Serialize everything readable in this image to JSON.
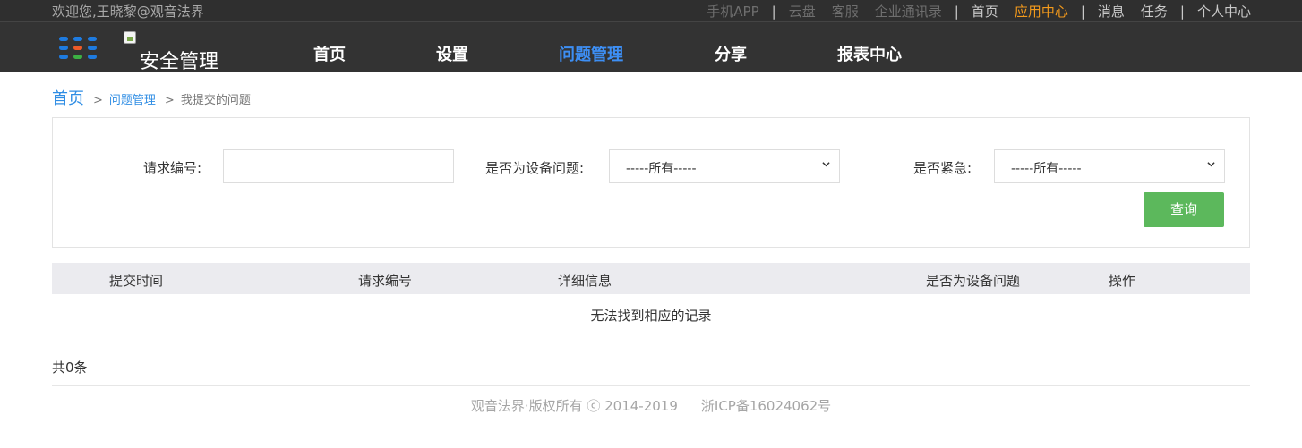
{
  "topbar": {
    "welcome": "欢迎您,王晓黎@观音法界",
    "links": {
      "mobile_app": "手机APP",
      "separator": "|",
      "cloud_disk": "云盘",
      "customer_service": "客服",
      "enterprise_contacts": "企业通讯录",
      "home": "首页",
      "app_center": "应用中心",
      "messages": "消息",
      "tasks": "任务",
      "personal_center": "个人中心"
    }
  },
  "nav": {
    "logo_alt": "安全管理",
    "items": [
      "首页",
      "设置",
      "问题管理",
      "分享",
      "报表中心"
    ],
    "active_item": "问题管理",
    "active_color": "#3d8ff5"
  },
  "breadcrumb": {
    "home": "首页",
    "separator": ">",
    "section": "问题管理",
    "current": "我提交的问题"
  },
  "filters": {
    "request_no": {
      "label": "请求编号:",
      "value": ""
    },
    "is_equipment": {
      "label": "是否为设备问题:",
      "selected": "-----所有-----"
    },
    "is_urgent": {
      "label": "是否紧急:",
      "selected": "-----所有-----"
    },
    "query_button": "查询"
  },
  "table": {
    "columns": [
      "提交时间",
      "请求编号",
      "详细信息",
      "是否为设备问题",
      "操作"
    ],
    "rows": [],
    "empty_text": "无法找到相应的记录"
  },
  "summary": {
    "total": "共0条"
  },
  "footer": {
    "copyright": "观音法界·版权所有 ⓒ 2014-2019",
    "icp": "浙ICP备16024062号"
  },
  "colors": {
    "topbar_bg": "#2f2f2f",
    "navbar_bg": "#333333",
    "accent_orange": "#f39a1c",
    "link_blue": "#2f8de4",
    "button_green": "#5cb85c"
  }
}
